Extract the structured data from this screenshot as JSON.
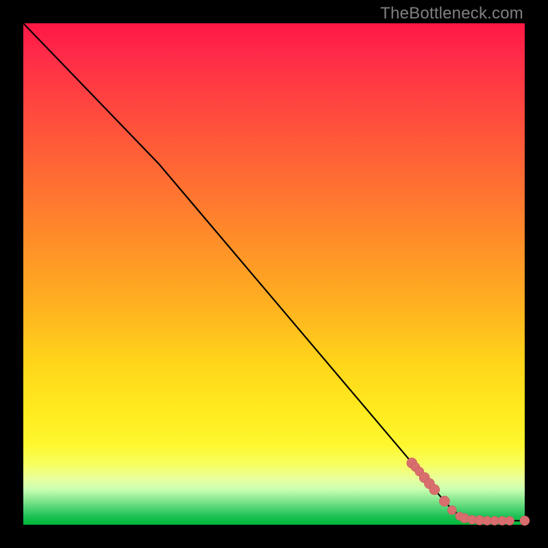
{
  "watermark": "TheBottleneck.com",
  "colors": {
    "frame": "#000000",
    "line": "#000000",
    "marker_fill": "#d86e6e",
    "marker_stroke": "#c85c5c"
  },
  "chart_data": {
    "type": "line",
    "title": "",
    "xlabel": "",
    "ylabel": "",
    "xlim": [
      0,
      100
    ],
    "ylim": [
      0,
      100
    ],
    "line": {
      "x": [
        0,
        27,
        84.5,
        88,
        100
      ],
      "y": [
        100,
        72,
        4.1,
        0.8,
        0.8
      ]
    },
    "series": [
      {
        "name": "markers",
        "x": [
          77.5,
          78.2,
          79.0,
          80.0,
          81.0,
          82.0,
          84.0,
          85.5,
          87.0,
          88.0,
          89.5,
          91.0,
          92.5,
          94.0,
          95.5,
          97.0,
          100.0
        ],
        "y": [
          12.3,
          11.5,
          10.6,
          9.4,
          8.2,
          7.0,
          4.7,
          2.9,
          1.7,
          1.3,
          1.0,
          0.9,
          0.8,
          0.8,
          0.8,
          0.8,
          0.8
        ],
        "r": [
          7.5,
          6.5,
          6.5,
          7.5,
          7.5,
          7.5,
          7.5,
          6.5,
          6.0,
          7.0,
          6.5,
          7.0,
          6.5,
          6.5,
          6.5,
          6.5,
          7.0
        ]
      }
    ]
  }
}
